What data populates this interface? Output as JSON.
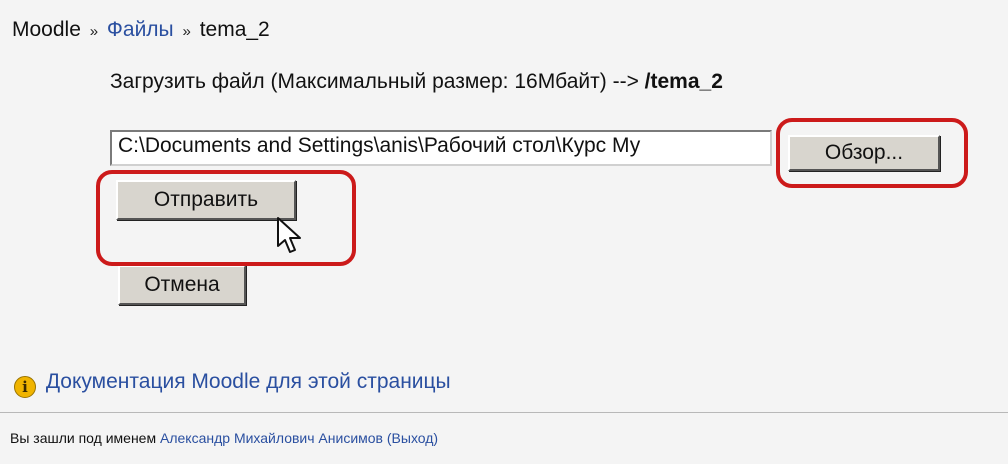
{
  "breadcrumb": {
    "home": "Moodle",
    "sep1": "»",
    "files": "Файлы",
    "sep2": "»",
    "current": "tema_2"
  },
  "upload": {
    "heading_text": "Загрузить файл (Максимальный размер: 16Мбайт) --> ",
    "target": "/tema_2",
    "file_value": "C:\\Documents and Settings\\anis\\Рабочий стол\\Курс Му",
    "browse_label": "Обзор...",
    "submit_label": "Отправить",
    "cancel_label": "Отмена"
  },
  "docs": {
    "icon": "info-icon",
    "icon_glyph": "i",
    "link_label": "Документация Moodle для этой страницы"
  },
  "footer": {
    "logged_in_prefix": "Вы зашли под именем ",
    "user_name": "Александр Михайлович Анисимов",
    "logout_label": "(Выход)"
  },
  "colors": {
    "link": "#2a4fa0",
    "highlight": "#cc1a1a",
    "background": "#f4f4f4",
    "button": "#d8d5ce"
  }
}
